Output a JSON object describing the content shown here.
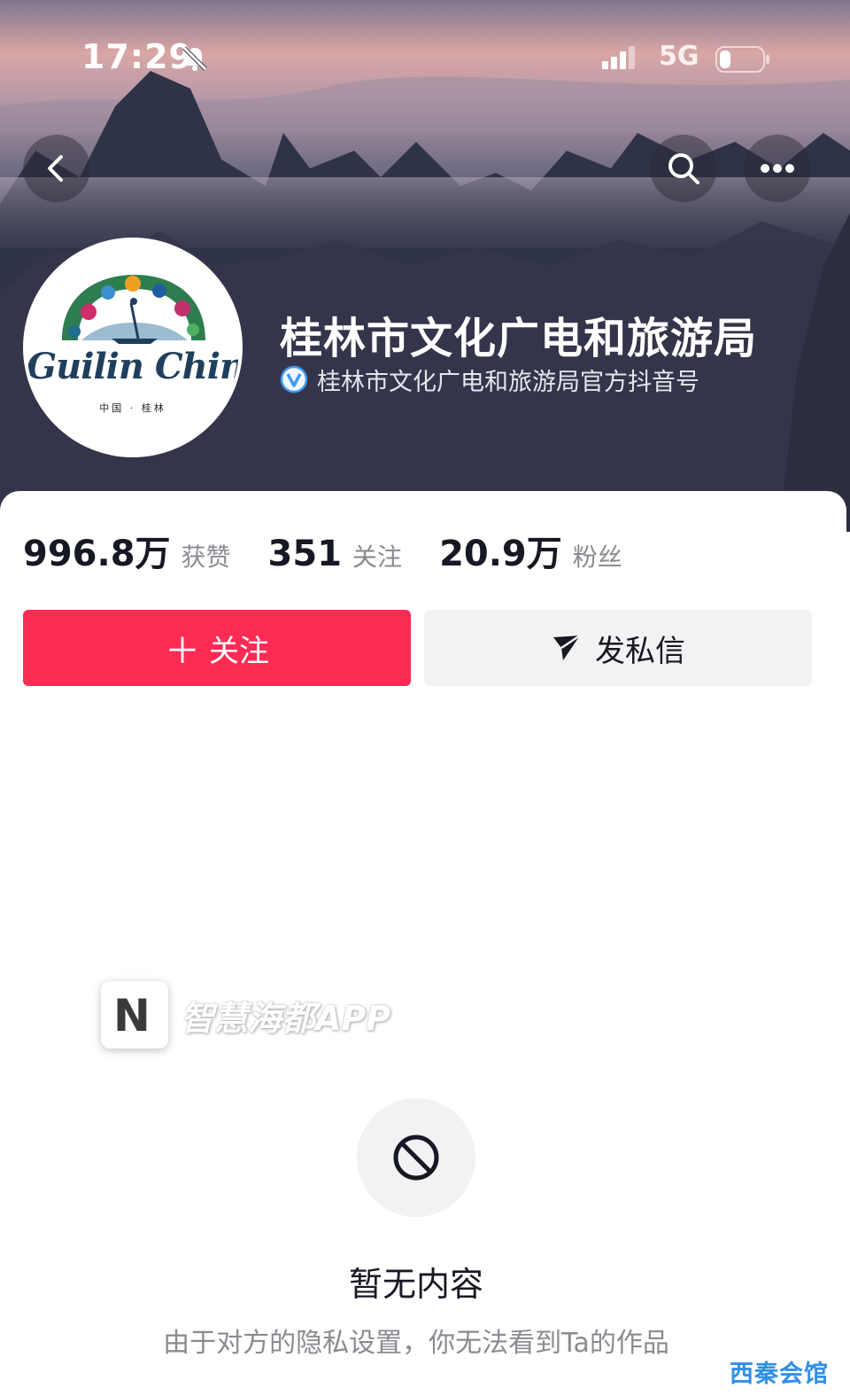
{
  "status_bar": {
    "time": "17:29",
    "network": "5G"
  },
  "header": {
    "back_icon": "chevron-left-icon",
    "search_icon": "search-icon",
    "more_icon": "more-dots-icon"
  },
  "profile": {
    "avatar_logo_text": "Guilin China",
    "avatar_logo_sub": "中国 · 桂林",
    "name": "桂林市文化广电和旅游局",
    "verified_text": "桂林市文化广电和旅游局官方抖音号"
  },
  "stats": [
    {
      "value": "996.8万",
      "label": "获赞"
    },
    {
      "value": "351",
      "label": "关注"
    },
    {
      "value": "20.9万",
      "label": "粉丝"
    }
  ],
  "actions": {
    "follow_label": "关注",
    "message_label": "发私信"
  },
  "watermark": {
    "text": "智慧海都APP",
    "logo_letter": "N",
    "corner": "西秦会馆"
  },
  "empty_state": {
    "title": "暂无内容",
    "description": "由于对方的隐私设置，你无法看到Ta的作品"
  },
  "colors": {
    "follow_button": "#fe2c55",
    "message_button": "#f2f2f4",
    "stat_label": "#8a8b91"
  }
}
